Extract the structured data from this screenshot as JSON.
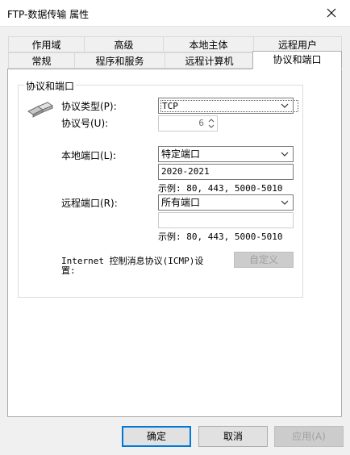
{
  "window": {
    "title": "FTP-数据传输 属性"
  },
  "tabs_row1": [
    "作用域",
    "高级",
    "本地主体",
    "远程用户"
  ],
  "tabs_row2": [
    "常规",
    "程序和服务",
    "远程计算机",
    "协议和端口"
  ],
  "group": {
    "title": "协议和端口",
    "protocol_type_label": "协议类型(P):",
    "protocol_type_value": "TCP",
    "protocol_number_label": "协议号(U):",
    "protocol_number_value": "6",
    "local_port_label": "本地端口(L):",
    "local_port_select": "特定端口",
    "local_port_value": "2020-2021",
    "local_port_example": "示例: 80, 443, 5000-5010",
    "remote_port_label": "远程端口(R):",
    "remote_port_select": "所有端口",
    "remote_port_value": "",
    "remote_port_example": "示例: 80, 443, 5000-5010",
    "icmp_label_line1": "Internet 控制消息协议(ICMP)设",
    "icmp_label_line2": "置:",
    "customize_button": "自定义"
  },
  "buttons": {
    "ok": "确定",
    "cancel": "取消",
    "apply": "应用(A)"
  },
  "colors": {
    "accent": "#0078d7",
    "border": "#adadad",
    "background": "#f0f0f0"
  }
}
